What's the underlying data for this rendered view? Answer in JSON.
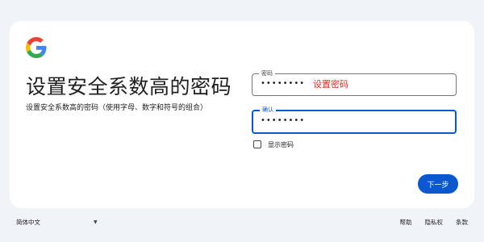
{
  "brand": {
    "logo_icon": "google-g-logo",
    "colors": {
      "blue": "#4285F4",
      "red": "#EA4335",
      "yellow": "#FBBC05",
      "green": "#34A853"
    }
  },
  "main": {
    "title": "设置安全系数高的密码",
    "subtitle": "设置安全系数高的密码（使用字母、数字和符号的组合）"
  },
  "form": {
    "password": {
      "label": "密码",
      "value": "••••••••",
      "annotation": "设置密码"
    },
    "confirm": {
      "label": "确认",
      "value": "••••••••"
    },
    "show_password": {
      "label": "显示密码",
      "checked": false
    },
    "next_label": "下一步"
  },
  "footer": {
    "language": "简体中文",
    "language_icon": "caret-down-icon",
    "links": [
      "帮助",
      "隐私权",
      "条款"
    ]
  },
  "colors": {
    "accent": "#0b57d0",
    "annotation": "#d93025",
    "page_bg": "#f0f4f9"
  }
}
